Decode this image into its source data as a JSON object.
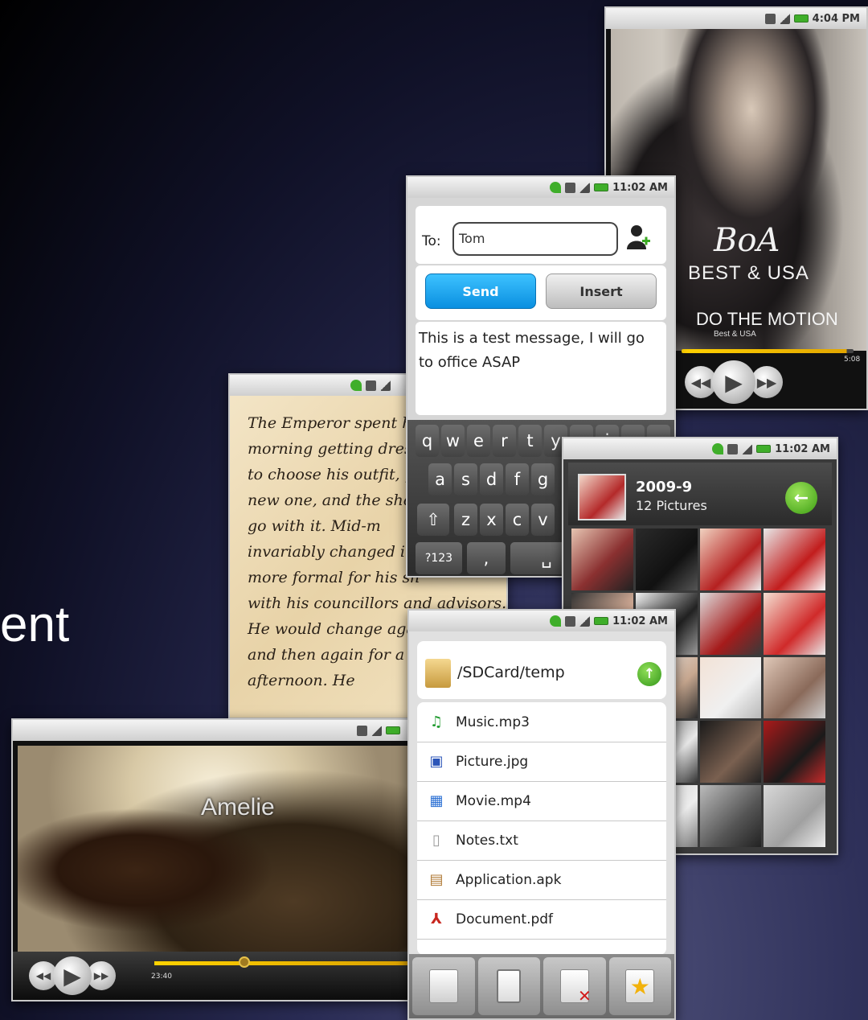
{
  "slide": {
    "partial_text": "ent"
  },
  "music_app": {
    "time": "4:04 PM",
    "album_artist_logo": "BoA",
    "album_subtitle": "BEST & USA",
    "song_title": "DO THE MOTION",
    "song_album": "Best & USA",
    "elapsed": "5:08",
    "progress": 0.96,
    "controls": [
      "rewind",
      "play",
      "fast-forward"
    ]
  },
  "message_app": {
    "time": "11:02 AM",
    "to_label": "To:",
    "to_value": "Tom",
    "send_label": "Send",
    "insert_label": "Insert",
    "body": "This is a test message, I will go to office ASAP",
    "keys_row1": [
      "q",
      "w",
      "e",
      "r",
      "t",
      "y",
      "u",
      "i",
      "o",
      "p"
    ],
    "keys_row2": [
      "a",
      "s",
      "d",
      "f",
      "g"
    ],
    "keys_row3": [
      "z",
      "x",
      "c",
      "v"
    ],
    "key_symbols": "?123",
    "key_comma": ","
  },
  "book_app": {
    "text": "The Emperor spent h\nmorning getting dress\nto choose his outfit, p\nnew one, and the shoes\ngo with it. Mid-m\ninvariably changed into\nmore formal for his sh\nwith his councillors and advisors.\nHe would change agai\nand then again for a\nafternoon. He"
  },
  "gallery_app": {
    "time": "11:02 AM",
    "album_date": "2009-9",
    "album_count": "12 Pictures"
  },
  "video_app": {
    "title": "Amelie",
    "elapsed": "23:40",
    "progress": 0.35,
    "controls": [
      "rewind",
      "play",
      "fast-forward"
    ]
  },
  "file_app": {
    "time": "11:02 AM",
    "path": "/SDCard/temp",
    "files": [
      {
        "name": "Music.mp3",
        "icon": "music-note-icon",
        "color": "#1f9a2e"
      },
      {
        "name": "Picture.jpg",
        "icon": "picture-icon",
        "color": "#2b55b8"
      },
      {
        "name": "Movie.mp4",
        "icon": "movie-clapper-icon",
        "color": "#2a6fd3"
      },
      {
        "name": "Notes.txt",
        "icon": "text-file-icon",
        "color": "#9a9a9a"
      },
      {
        "name": "Application.apk",
        "icon": "package-icon",
        "color": "#b07a35"
      },
      {
        "name": "Document.pdf",
        "icon": "pdf-icon",
        "color": "#c8271f"
      }
    ],
    "toolbar": [
      "copy-icon",
      "paste-icon",
      "delete-icon",
      "favorite-icon"
    ]
  }
}
